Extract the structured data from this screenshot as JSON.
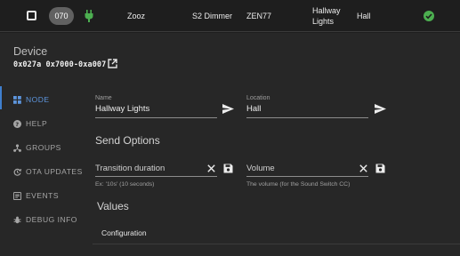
{
  "node_row": {
    "node_id": "070",
    "manufacturer": "Zooz",
    "product": "S2 Dimmer",
    "model": "ZEN77",
    "name_line1": "Hallway",
    "name_line2": "Lights",
    "location": "Hall",
    "status_color": "#4caf50"
  },
  "device": {
    "title": "Device",
    "identifier": "0x027a 0x7000-0xa007"
  },
  "sidebar": {
    "items": [
      {
        "label": "NODE",
        "icon": "grid-icon",
        "active": true
      },
      {
        "label": "HELP",
        "icon": "help-icon",
        "active": false
      },
      {
        "label": "GROUPS",
        "icon": "groups-icon",
        "active": false
      },
      {
        "label": "OTA UPDATES",
        "icon": "update-icon",
        "active": false
      },
      {
        "label": "EVENTS",
        "icon": "events-icon",
        "active": false
      },
      {
        "label": "DEBUG INFO",
        "icon": "bug-icon",
        "active": false
      }
    ]
  },
  "node": {
    "name_label": "Name",
    "name_value": "Hallway Lights",
    "location_label": "Location",
    "location_value": "Hall",
    "send_options_title": "Send Options",
    "transition_placeholder": "Transition duration",
    "transition_hint": "Ex: '10s' (10 seconds)",
    "volume_placeholder": "Volume",
    "volume_hint": "The volume (for the Sound Switch CC)",
    "values_title": "Values",
    "configuration_label": "Configuration"
  },
  "colors": {
    "accent": "#5d95dd",
    "background": "#272727"
  }
}
